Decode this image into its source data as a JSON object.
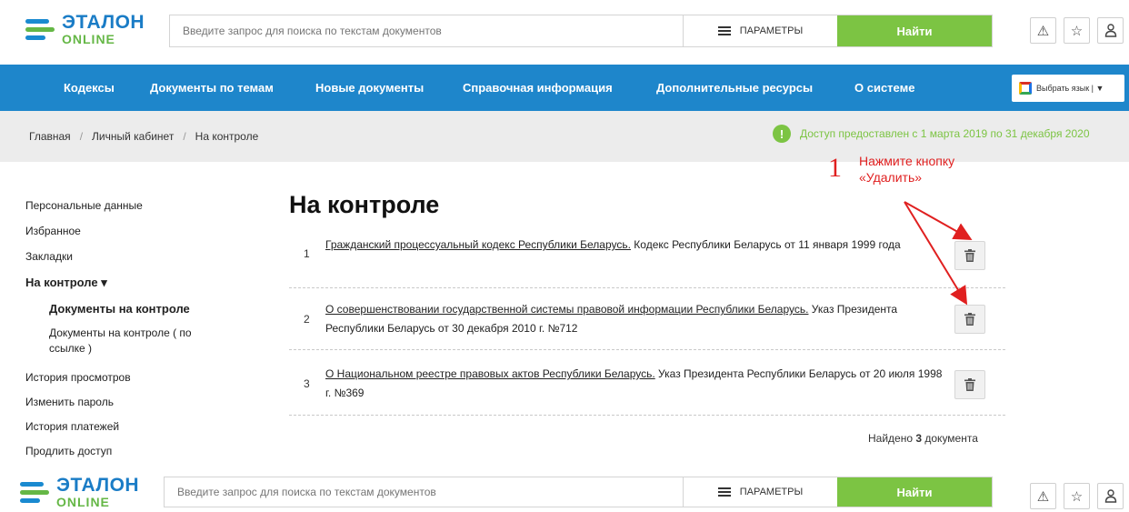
{
  "logo": {
    "main": "ЭТАЛОН",
    "sub": "ONLINE"
  },
  "search": {
    "placeholder": "Введите запрос для поиска по текстам документов",
    "params_label": "ПАРАМЕТРЫ",
    "find_label": "Найти"
  },
  "header_icons": [
    "warning-icon",
    "star-icon",
    "user-icon"
  ],
  "nav": {
    "items": [
      "Кодексы",
      "Документы по темам",
      "Новые документы",
      "Справочная информация",
      "Дополнительные ресурсы",
      "О системе"
    ],
    "lang_label": "Выбрать язык | ▼"
  },
  "breadcrumb": [
    "Главная",
    "Личный кабинет",
    "На контроле"
  ],
  "access_text": "Доступ предоставлен с 1 марта 2019 по 31 декабря 2020",
  "sidebar": {
    "items": [
      "Персональные данные",
      "Избранное",
      "Закладки",
      "На контроле ▾"
    ],
    "subitems": [
      "Документы на контроле",
      "Документы на контроле ( по ссылке )"
    ],
    "items_after": [
      "История просмотров",
      "Изменить пароль",
      "История платежей",
      "Продлить доступ"
    ]
  },
  "page_title": "На контроле",
  "documents": [
    {
      "num": "1",
      "link": "Гражданский процессуальный кодекс Республики Беларусь.",
      "rest": " Кодекс Республики Беларусь от 11 января 1999 года"
    },
    {
      "num": "2",
      "link": "О совершенствовании государственной системы правовой информации Республики Беларусь.",
      "rest": " Указ Президента Республики Беларусь от 30 декабря 2010 г. №712"
    },
    {
      "num": "3",
      "link": "О Национальном реестре правовых актов Республики Беларусь.",
      "rest": " Указ Президента Республики Беларусь от 20 июля 1998 г. №369"
    }
  ],
  "found": {
    "prefix": "Найдено ",
    "count": "3",
    "suffix": " документа"
  },
  "annotation": {
    "num": "1",
    "text": "Нажмите кнопку «Удалить»"
  },
  "colors": {
    "brand_blue": "#1e86cb",
    "brand_green": "#7cc443",
    "annotation_red": "#e02020"
  }
}
